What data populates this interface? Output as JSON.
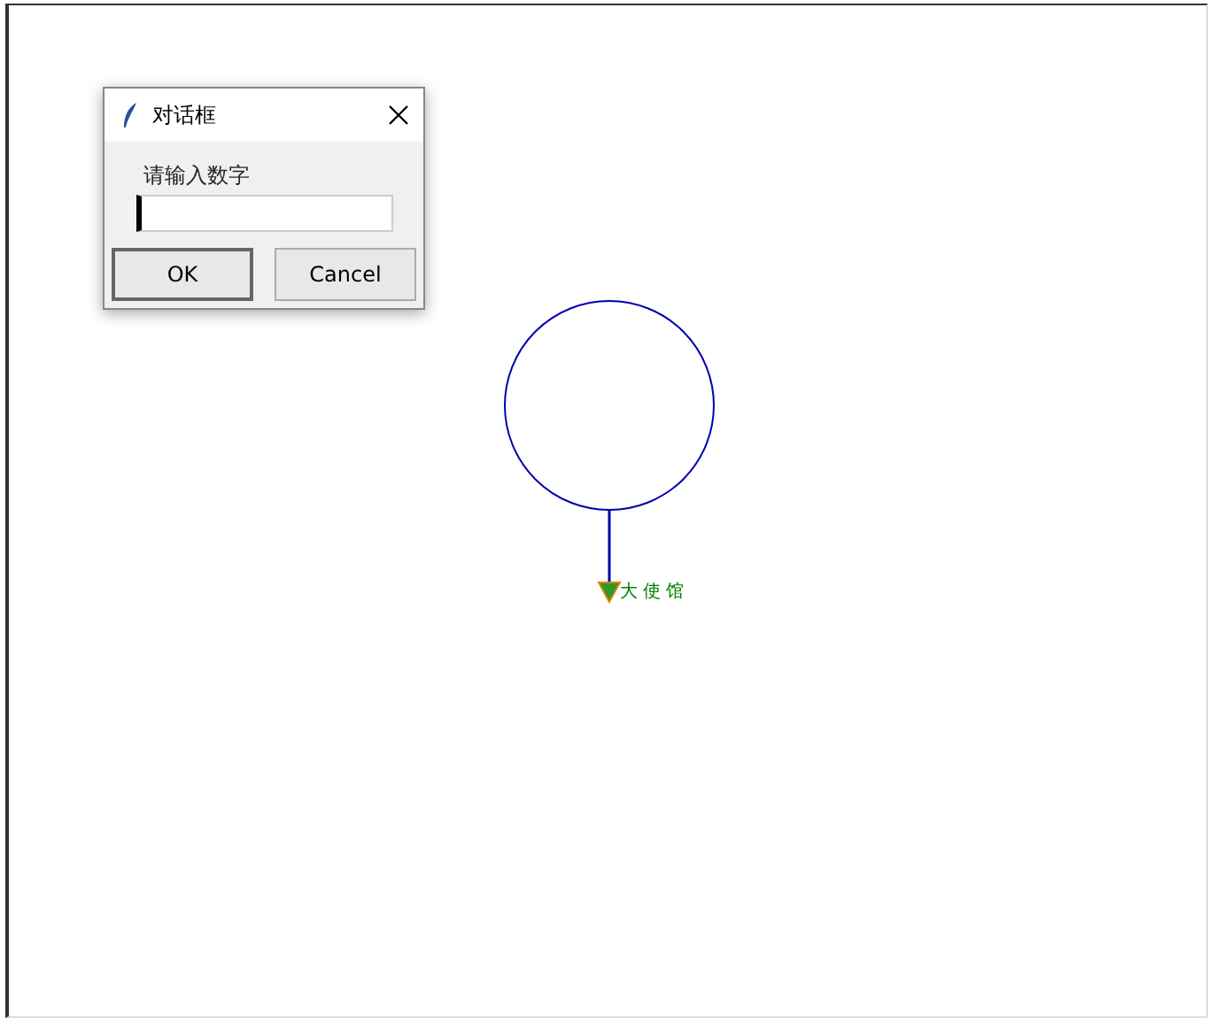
{
  "dialog": {
    "title": "对话框",
    "prompt": "请输入数字",
    "buttons": [
      {
        "label": "OK",
        "default": true
      },
      {
        "label": "Cancel",
        "default": false
      }
    ]
  },
  "canvas": {
    "label": "大使馆"
  }
}
